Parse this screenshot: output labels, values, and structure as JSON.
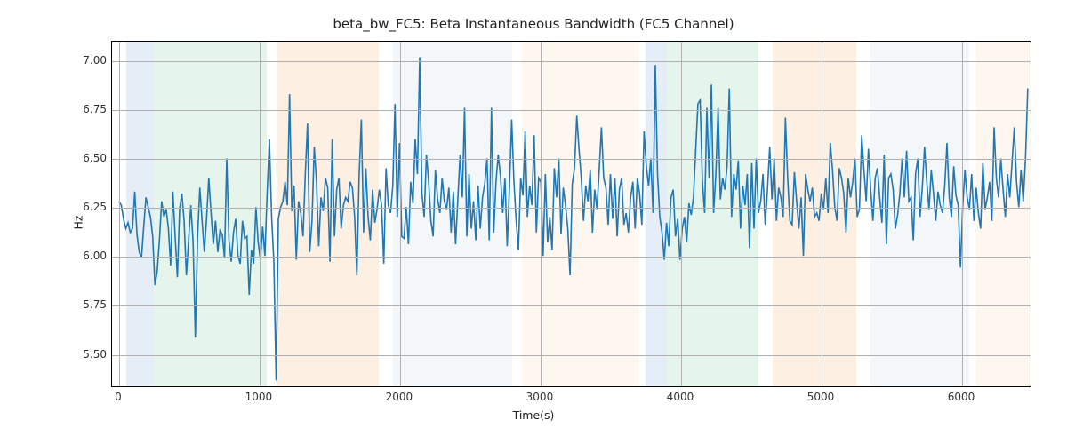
{
  "chart_data": {
    "type": "line",
    "title": "beta_bw_FC5: Beta Instantaneous Bandwidth (FC5 Channel)",
    "xlabel": "Time(s)",
    "ylabel": "Hz",
    "xlim": [
      -50,
      6500
    ],
    "ylim": [
      5.33,
      7.1
    ],
    "xticks": [
      0,
      1000,
      2000,
      3000,
      4000,
      5000,
      6000
    ],
    "yticks": [
      5.5,
      5.75,
      6.0,
      6.25,
      6.5,
      6.75,
      7.0
    ],
    "line_color": "#1f77b4",
    "bands": [
      {
        "x0": 50,
        "x1": 250,
        "color": "#a8c6e6"
      },
      {
        "x0": 250,
        "x1": 1050,
        "color": "#a9dfbf"
      },
      {
        "x0": 1130,
        "x1": 1850,
        "color": "#f9cb9c"
      },
      {
        "x0": 1950,
        "x1": 2800,
        "color": "#d6e4f0"
      },
      {
        "x0": 2870,
        "x1": 3700,
        "color": "#fce5cd"
      },
      {
        "x0": 3750,
        "x1": 3900,
        "color": "#a8c6e6"
      },
      {
        "x0": 3900,
        "x1": 4550,
        "color": "#a9dfbf"
      },
      {
        "x0": 4650,
        "x1": 5250,
        "color": "#f9cb9c"
      },
      {
        "x0": 5350,
        "x1": 6050,
        "color": "#d6e4f0"
      },
      {
        "x0": 6100,
        "x1": 6500,
        "color": "#fce5cd"
      }
    ],
    "series": [
      {
        "name": "beta_bw_FC5",
        "x_step": 16,
        "y": [
          6.28,
          6.26,
          6.19,
          6.14,
          6.17,
          6.12,
          6.14,
          6.33,
          6.11,
          6.02,
          5.99,
          6.15,
          6.3,
          6.25,
          6.2,
          6.1,
          5.85,
          5.92,
          6.08,
          6.28,
          6.2,
          6.24,
          6.14,
          5.95,
          6.33,
          6.1,
          5.89,
          6.24,
          6.32,
          6.18,
          5.9,
          6.08,
          6.26,
          6.07,
          5.58,
          6.1,
          6.35,
          6.18,
          6.02,
          6.19,
          6.4,
          6.22,
          6.06,
          6.18,
          6.02,
          6.13,
          6.11,
          5.99,
          6.5,
          6.08,
          5.97,
          6.12,
          6.19,
          6.0,
          5.96,
          6.18,
          6.09,
          6.1,
          5.8,
          6.03,
          5.96,
          6.25,
          6.07,
          5.98,
          6.15,
          6.0,
          6.32,
          6.6,
          6.2,
          5.97,
          5.36,
          6.19,
          6.25,
          6.28,
          6.38,
          6.26,
          6.83,
          6.23,
          6.36,
          5.98,
          6.28,
          6.22,
          6.1,
          6.42,
          6.68,
          6.02,
          6.18,
          6.56,
          6.38,
          6.05,
          6.3,
          6.23,
          6.4,
          6.35,
          5.97,
          6.6,
          6.1,
          6.34,
          6.4,
          6.14,
          6.26,
          6.3,
          6.28,
          6.38,
          6.35,
          6.2,
          5.9,
          6.41,
          6.7,
          6.12,
          6.45,
          6.2,
          6.08,
          6.34,
          6.17,
          6.24,
          6.34,
          6.26,
          5.96,
          6.45,
          6.26,
          6.22,
          6.36,
          6.78,
          6.2,
          6.58,
          6.1,
          6.09,
          6.25,
          6.06,
          6.38,
          6.27,
          6.6,
          6.42,
          7.02,
          6.32,
          6.2,
          6.52,
          6.38,
          6.18,
          6.1,
          6.44,
          6.29,
          6.22,
          6.4,
          6.28,
          6.24,
          6.35,
          6.12,
          6.33,
          6.06,
          6.29,
          6.52,
          6.3,
          6.76,
          6.1,
          6.42,
          6.14,
          6.28,
          6.08,
          6.36,
          6.14,
          6.3,
          6.37,
          6.5,
          6.08,
          6.76,
          6.12,
          6.38,
          6.52,
          6.41,
          6.22,
          6.4,
          6.05,
          6.35,
          6.7,
          6.38,
          6.18,
          6.03,
          6.4,
          6.31,
          6.64,
          6.2,
          6.36,
          6.26,
          6.62,
          6.12,
          6.4,
          6.38,
          6.0,
          6.42,
          6.07,
          6.2,
          6.03,
          6.45,
          6.3,
          6.5,
          6.11,
          6.35,
          6.26,
          6.14,
          5.9,
          6.37,
          6.45,
          6.72,
          6.55,
          6.4,
          6.18,
          6.36,
          6.28,
          6.44,
          6.12,
          6.34,
          6.24,
          6.44,
          6.66,
          6.4,
          6.35,
          6.16,
          6.42,
          6.19,
          6.4,
          6.1,
          6.34,
          6.4,
          6.16,
          6.22,
          6.12,
          6.3,
          6.38,
          6.14,
          6.4,
          6.32,
          6.16,
          6.64,
          6.46,
          6.36,
          6.5,
          6.22,
          6.98,
          6.42,
          6.2,
          6.12,
          5.98,
          6.17,
          6.05,
          6.3,
          6.34,
          6.1,
          6.19,
          5.98,
          6.14,
          6.2,
          6.07,
          6.27,
          6.21,
          6.3,
          6.54,
          6.78,
          6.8,
          6.38,
          6.22,
          6.76,
          6.4,
          6.88,
          6.22,
          6.42,
          6.76,
          6.29,
          6.4,
          6.34,
          6.46,
          6.86,
          6.2,
          6.42,
          6.34,
          6.49,
          6.14,
          6.36,
          6.26,
          6.42,
          6.04,
          6.48,
          6.14,
          6.5,
          6.22,
          6.28,
          6.42,
          6.16,
          6.34,
          6.56,
          6.29,
          6.5,
          6.18,
          6.35,
          6.3,
          6.2,
          6.71,
          6.4,
          6.18,
          6.16,
          6.43,
          6.28,
          6.14,
          6.3,
          6.0,
          6.42,
          6.34,
          6.28,
          6.35,
          6.2,
          6.22,
          6.18,
          6.32,
          6.24,
          6.4,
          6.22,
          6.58,
          6.44,
          6.25,
          6.18,
          6.45,
          6.4,
          6.32,
          6.12,
          6.4,
          6.3,
          6.38,
          6.5,
          6.2,
          6.24,
          6.62,
          6.44,
          6.28,
          6.55,
          6.34,
          6.18,
          6.4,
          6.45,
          6.3,
          6.17,
          6.52,
          6.06,
          6.4,
          6.42,
          6.34,
          6.14,
          6.21,
          6.32,
          6.5,
          6.3,
          6.54,
          6.28,
          6.3,
          6.08,
          6.42,
          6.5,
          6.2,
          6.35,
          6.56,
          6.38,
          6.24,
          6.44,
          6.32,
          6.18,
          6.33,
          6.26,
          6.22,
          6.36,
          6.58,
          6.3,
          6.2,
          6.46,
          6.31,
          6.26,
          5.94,
          6.25,
          6.44,
          6.3,
          6.24,
          6.42,
          6.18,
          6.35,
          6.22,
          6.14,
          6.48,
          6.24,
          6.3,
          6.38,
          6.18,
          6.66,
          6.4,
          6.3,
          6.5,
          6.34,
          6.2,
          6.42,
          6.3,
          6.48,
          6.66,
          6.38,
          6.25,
          6.44,
          6.28,
          6.5,
          6.86
        ]
      }
    ]
  }
}
